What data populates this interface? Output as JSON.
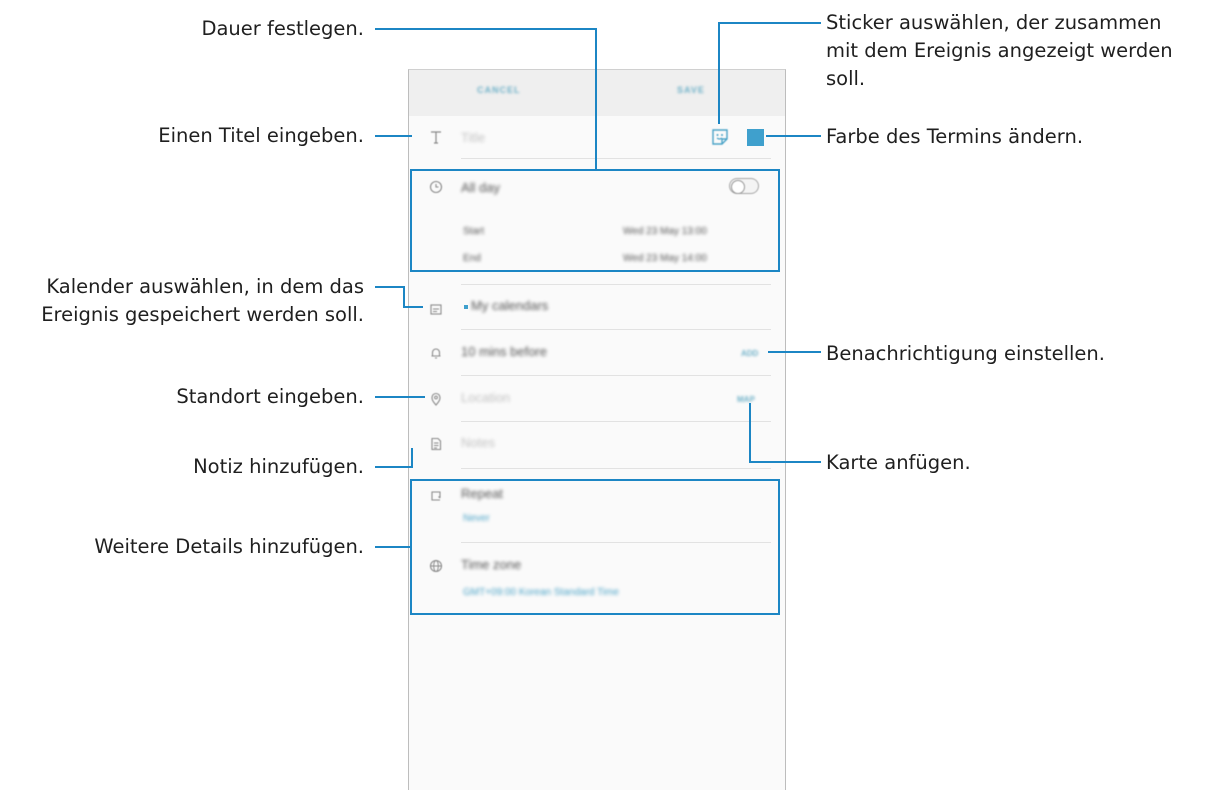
{
  "annotations": {
    "duration": "Dauer festlegen.",
    "title": "Einen Titel eingeben.",
    "calendar_line1": "Kalender auswählen, in dem das",
    "calendar_line2": "Ereignis gespeichert werden soll.",
    "location": "Standort eingeben.",
    "note": "Notiz hinzufügen.",
    "more_details": "Weitere Details hinzufügen.",
    "sticker_line1": "Sticker auswählen, der zusammen",
    "sticker_line2": "mit dem Ereignis angezeigt werden",
    "sticker_line3": "soll.",
    "color": "Farbe des Termins ändern.",
    "notification": "Benachrichtigung einstellen.",
    "map": "Karte anfügen."
  },
  "app": {
    "cancel_label": "CANCEL",
    "save_label": "SAVE",
    "title_placeholder": "Title",
    "all_day_label": "All day",
    "start_label": "Start",
    "start_value": "Wed 23 May   13:00",
    "end_label": "End",
    "end_value": "Wed 23 May   14:00",
    "calendar_value": "My calendars",
    "reminder_value": "10 mins before",
    "reminder_add": "ADD",
    "location_placeholder": "Location",
    "map_label": "MAP",
    "notes_placeholder": "Notes",
    "repeat_label": "Repeat",
    "repeat_value": "Never",
    "timezone_label": "Time zone",
    "timezone_value": "GMT+09:00 Korean Standard Time"
  },
  "colors": {
    "accent": "#1c86c4",
    "event_color": "#3fa0cd"
  }
}
